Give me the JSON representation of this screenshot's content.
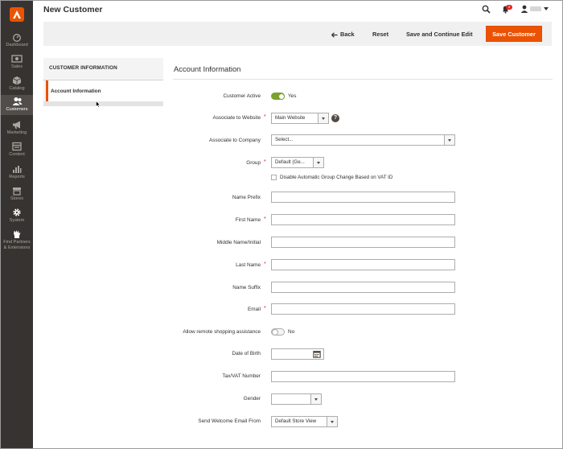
{
  "page": {
    "title": "New Customer"
  },
  "colors": {
    "accent": "#eb5202",
    "sidebar": "#373330",
    "toggle_on": "#79a22e",
    "required": "#e22626"
  },
  "sidebar": {
    "items": [
      {
        "label": "Dashboard",
        "icon": "dashboard-icon"
      },
      {
        "label": "Sales",
        "icon": "dollar-icon"
      },
      {
        "label": "Catalog",
        "icon": "box-icon"
      },
      {
        "label": "Customers",
        "icon": "customers-icon",
        "active": true
      },
      {
        "label": "Marketing",
        "icon": "megaphone-icon"
      },
      {
        "label": "Content",
        "icon": "content-icon"
      },
      {
        "label": "Reports",
        "icon": "bar-chart-icon"
      },
      {
        "label": "Stores",
        "icon": "store-icon"
      },
      {
        "label": "System",
        "icon": "gear-icon"
      },
      {
        "label": "Find Partners",
        "label2": "& Extensions",
        "icon": "puzzle-icon"
      }
    ]
  },
  "header": {
    "notification_count": "4",
    "user_name": ""
  },
  "toolbar": {
    "back_label": "Back",
    "reset_label": "Reset",
    "save_continue_label": "Save and Continue Edit",
    "save_label": "Save Customer"
  },
  "tabs": {
    "title": "CUSTOMER INFORMATION",
    "items": [
      {
        "label": "Account Information",
        "active": true
      }
    ]
  },
  "section": {
    "title": "Account Information"
  },
  "form": {
    "customer_active": {
      "label": "Customer Active",
      "value": "Yes",
      "on": true
    },
    "associate_website": {
      "label": "Associate to Website",
      "value": "Main Website"
    },
    "associate_company": {
      "label": "Associate to Company",
      "value": "Select..."
    },
    "group": {
      "label": "Group",
      "value": "Default (Ge...",
      "checkbox_label": "Disable Automatic Group Change Based on VAT ID"
    },
    "name_prefix": {
      "label": "Name Prefix",
      "value": ""
    },
    "first_name": {
      "label": "First Name",
      "value": ""
    },
    "middle_name": {
      "label": "Middle Name/Initial",
      "value": ""
    },
    "last_name": {
      "label": "Last Name",
      "value": ""
    },
    "name_suffix": {
      "label": "Name Suffix",
      "value": ""
    },
    "email": {
      "label": "Email",
      "value": ""
    },
    "remote_assistance": {
      "label": "Allow remote shopping assistance",
      "value": "No",
      "on": false
    },
    "dob": {
      "label": "Date of Birth",
      "value": ""
    },
    "taxvat": {
      "label": "Tax/VAT Number",
      "value": ""
    },
    "gender": {
      "label": "Gender",
      "value": ""
    },
    "welcome_email": {
      "label": "Send Welcome Email From",
      "value": "Default Store View"
    }
  }
}
